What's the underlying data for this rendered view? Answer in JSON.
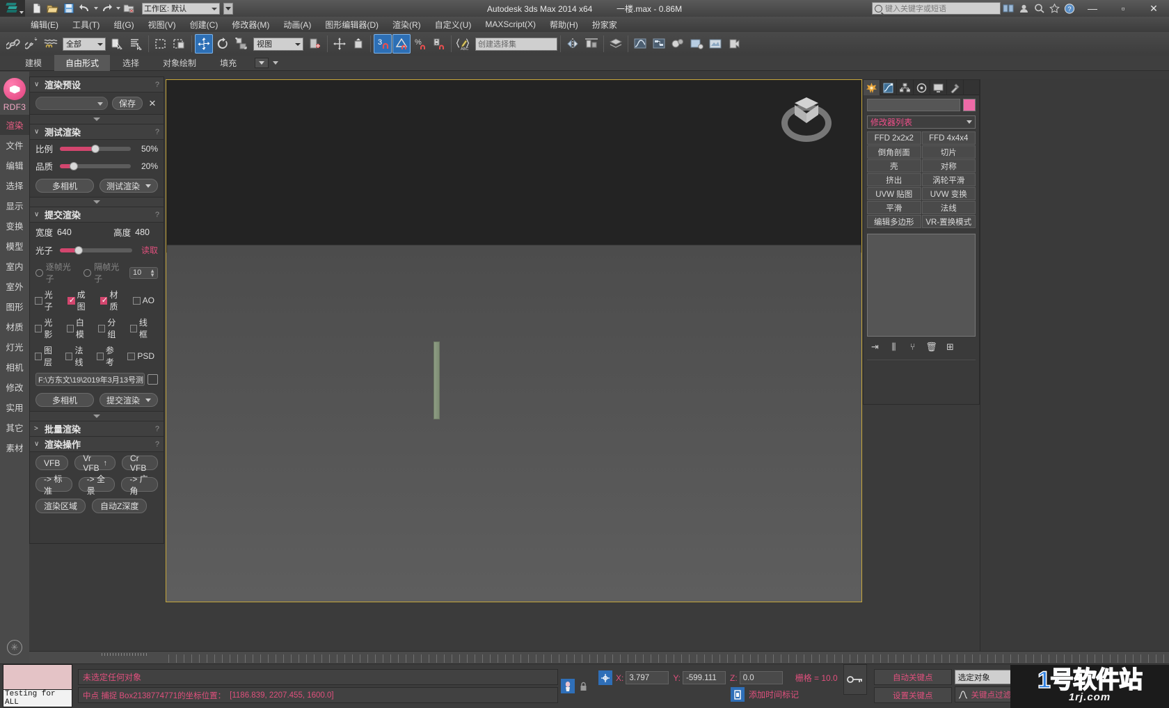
{
  "titlebar": {
    "workspace_label": "工作区: 默认",
    "app_title": "Autodesk 3ds Max  2014 x64",
    "file_title": "一楼.max - 0.86M",
    "search_placeholder": "键入关键字或短语",
    "minimize": "—",
    "maximize": "▫",
    "close": "✕"
  },
  "menu": {
    "items": [
      {
        "label": "编辑(E)"
      },
      {
        "label": "工具(T)"
      },
      {
        "label": "组(G)"
      },
      {
        "label": "视图(V)"
      },
      {
        "label": "创建(C)"
      },
      {
        "label": "修改器(M)"
      },
      {
        "label": "动画(A)"
      },
      {
        "label": "图形编辑器(D)"
      },
      {
        "label": "渲染(R)"
      },
      {
        "label": "自定义(U)"
      },
      {
        "label": "MAXScript(X)"
      },
      {
        "label": "帮助(H)"
      },
      {
        "label": "扮家家"
      }
    ]
  },
  "toolbar": {
    "filter_value": "全部",
    "ref_coord_value": "视图",
    "named_sel_placeholder": "创建选择集"
  },
  "ribbon": {
    "tabs": [
      {
        "label": "建模",
        "selected": false
      },
      {
        "label": "自由形式",
        "selected": true
      },
      {
        "label": "选择",
        "selected": false
      },
      {
        "label": "对象绘制",
        "selected": false
      },
      {
        "label": "填充",
        "selected": false
      }
    ]
  },
  "sidebar": {
    "brand": "RDF3",
    "items": [
      {
        "label": "渲染",
        "selected": true
      },
      {
        "label": "文件",
        "selected": false
      },
      {
        "label": "编辑",
        "selected": false
      },
      {
        "label": "选择",
        "selected": false
      },
      {
        "label": "显示",
        "selected": false
      },
      {
        "label": "变换",
        "selected": false
      },
      {
        "label": "模型",
        "selected": false
      },
      {
        "label": "室内",
        "selected": false
      },
      {
        "label": "室外",
        "selected": false
      },
      {
        "label": "图形",
        "selected": false
      },
      {
        "label": "材质",
        "selected": false
      },
      {
        "label": "灯光",
        "selected": false
      },
      {
        "label": "相机",
        "selected": false
      },
      {
        "label": "修改",
        "selected": false
      },
      {
        "label": "实用",
        "selected": false
      },
      {
        "label": "其它",
        "selected": false
      },
      {
        "label": "素材",
        "selected": false
      }
    ]
  },
  "render_panel": {
    "preset": {
      "title": "渲染预设",
      "help": "?",
      "combo_value": "",
      "save_label": "保存",
      "close_label": "✕"
    },
    "test_render": {
      "title": "测试渲染",
      "help": "?",
      "scale_label": "比例",
      "scale_value": "50%",
      "scale_percent": 50,
      "quality_label": "品质",
      "quality_value": "20%",
      "quality_percent": 20,
      "multicam_label": "多相机",
      "testrender_label": "测试渲染"
    },
    "submit_render": {
      "title": "提交渲染",
      "help": "?",
      "width_label": "宽度",
      "width_value": "640",
      "height_label": "高度",
      "height_value": "480",
      "photon_label": "光子",
      "photon_percent": 26,
      "read_label": "读取",
      "radio_per_frame": "逐帧光子",
      "radio_skip_frame": "隔帧光子",
      "skip_value": "10",
      "checks_row1": [
        {
          "label": "光子",
          "checked": false
        },
        {
          "label": "成图",
          "checked": true
        },
        {
          "label": "材质",
          "checked": true
        },
        {
          "label": "AO",
          "checked": false
        }
      ],
      "checks_row2": [
        {
          "label": "光影",
          "checked": false
        },
        {
          "label": "白模",
          "checked": false
        },
        {
          "label": "分组",
          "checked": false
        },
        {
          "label": "线框",
          "checked": false
        }
      ],
      "checks_row3": [
        {
          "label": "图层",
          "checked": false
        },
        {
          "label": "法线",
          "checked": false
        },
        {
          "label": "参考",
          "checked": false
        },
        {
          "label": "PSD",
          "checked": false
        }
      ],
      "path_value": "F:\\方东文\\19\\2019年3月13号测",
      "multicam_label": "多相机",
      "submit_label": "提交渲染"
    },
    "batch_render": {
      "title": "批量渲染",
      "help": "?"
    },
    "render_ops": {
      "title": "渲染操作",
      "help": "?",
      "buttons_row1": [
        {
          "label": "VFB"
        },
        {
          "label": "Vr VFB",
          "icon": "up-arrow-icon"
        },
        {
          "label": "Cr VFB"
        }
      ],
      "buttons_row2": [
        {
          "label": "-> 标准"
        },
        {
          "label": "-> 全景"
        },
        {
          "label": "-> 广角"
        }
      ],
      "buttons_row3": [
        {
          "label": "渲染区域"
        },
        {
          "label": "自动Z深度"
        }
      ]
    }
  },
  "command_panel": {
    "tabs": [
      {
        "name": "create-tab",
        "icon": "star-icon",
        "selected": true
      },
      {
        "name": "modify-tab",
        "icon": "curve-icon",
        "selected": false
      },
      {
        "name": "hierarchy-tab",
        "icon": "hierarchy-icon",
        "selected": false
      },
      {
        "name": "motion-tab",
        "icon": "wheel-icon",
        "selected": false
      },
      {
        "name": "display-tab",
        "icon": "display-icon",
        "selected": false
      },
      {
        "name": "utilities-tab",
        "icon": "hammer-icon",
        "selected": false
      }
    ],
    "object_name": "",
    "color_swatch": "#ee6aa7",
    "modifier_list_label": "修改器列表",
    "modifiers": [
      {
        "label": "FFD 2x2x2"
      },
      {
        "label": "FFD 4x4x4"
      },
      {
        "label": "倒角剖面"
      },
      {
        "label": "切片"
      },
      {
        "label": "壳"
      },
      {
        "label": "对称"
      },
      {
        "label": "挤出"
      },
      {
        "label": "涡轮平滑"
      },
      {
        "label": "UVW 贴图"
      },
      {
        "label": "UVW 变换"
      },
      {
        "label": "平滑"
      },
      {
        "label": "法线"
      },
      {
        "label": "编辑多边形"
      },
      {
        "label": "VR-置换模式"
      }
    ],
    "stack_tools": [
      {
        "name": "pin-stack-icon",
        "glyph": "⇥"
      },
      {
        "name": "show-end-result-icon",
        "glyph": "⫼"
      },
      {
        "name": "make-unique-icon",
        "glyph": "⑂"
      },
      {
        "name": "remove-modifier-icon",
        "glyph": "🗑"
      },
      {
        "name": "configure-sets-icon",
        "glyph": "⊞"
      }
    ]
  },
  "viewport": {
    "viewcube_name": "view-cube"
  },
  "status": {
    "preview_caption": "Testing for ALL",
    "line1": "未选定任何对象",
    "line2_prefix": "中点 捕捉 Box2138774771的坐标位置：",
    "line2_coords": "[1186.839, 2207.455, 1600.0]",
    "x_label": "X:",
    "x_value": "3.797",
    "y_label": "Y:",
    "y_value": "-599.111",
    "z_label": "Z:",
    "z_value": "0.0",
    "grid_label": "栅格 = 10.0",
    "add_time_tag": "添加时间标记",
    "auto_key": "自动关键点",
    "set_key": "设置关键点",
    "key_filters": "关键点过滤器...",
    "selection_mode": "选定对象"
  },
  "watermark": {
    "line1": "1号软件站",
    "line2": "1rj.com"
  }
}
